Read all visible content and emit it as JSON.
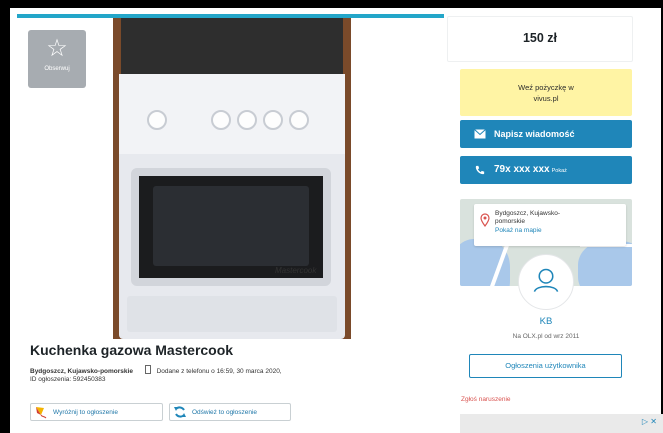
{
  "listing": {
    "observe_label": "Obserwuj",
    "title": "Kuchenka gazowa Mastercook",
    "location": "Bydgoszcz, Kujawsko-pomorskie",
    "added_text": "Dodane z telefonu  o 16:59, 30 marca 2020,",
    "ad_id_text": "ID ogłoszenia: 592450383",
    "feature_button": "Wyróżnij to ogłoszenie",
    "refresh_button": "Odśwież to ogłoszenie",
    "brand_text": "Mastercook"
  },
  "sidebar": {
    "price": "150 zł",
    "loan_line1": "Weź pożyczkę w",
    "loan_line2": "vivus.pl",
    "message_button": "Napisz wiadomość",
    "phone_number": "79x xxx xxx",
    "phone_show": "Pokaż",
    "map_location_line1": "Bydgoszcz, Kujawsko-",
    "map_location_line2": "pomorskie",
    "map_link": "Pokaż na mapie",
    "seller_name": "KB",
    "seller_since": "Na OLX.pl od wrz 2011",
    "user_ads_button": "Ogłoszenia użytkownika",
    "report_link": "Zgłoś naruszenie"
  },
  "colors": {
    "accent": "#1f86b9",
    "loan_bg": "#fff4a4",
    "observe_bg": "#a7acb1",
    "report": "#d9534f"
  }
}
